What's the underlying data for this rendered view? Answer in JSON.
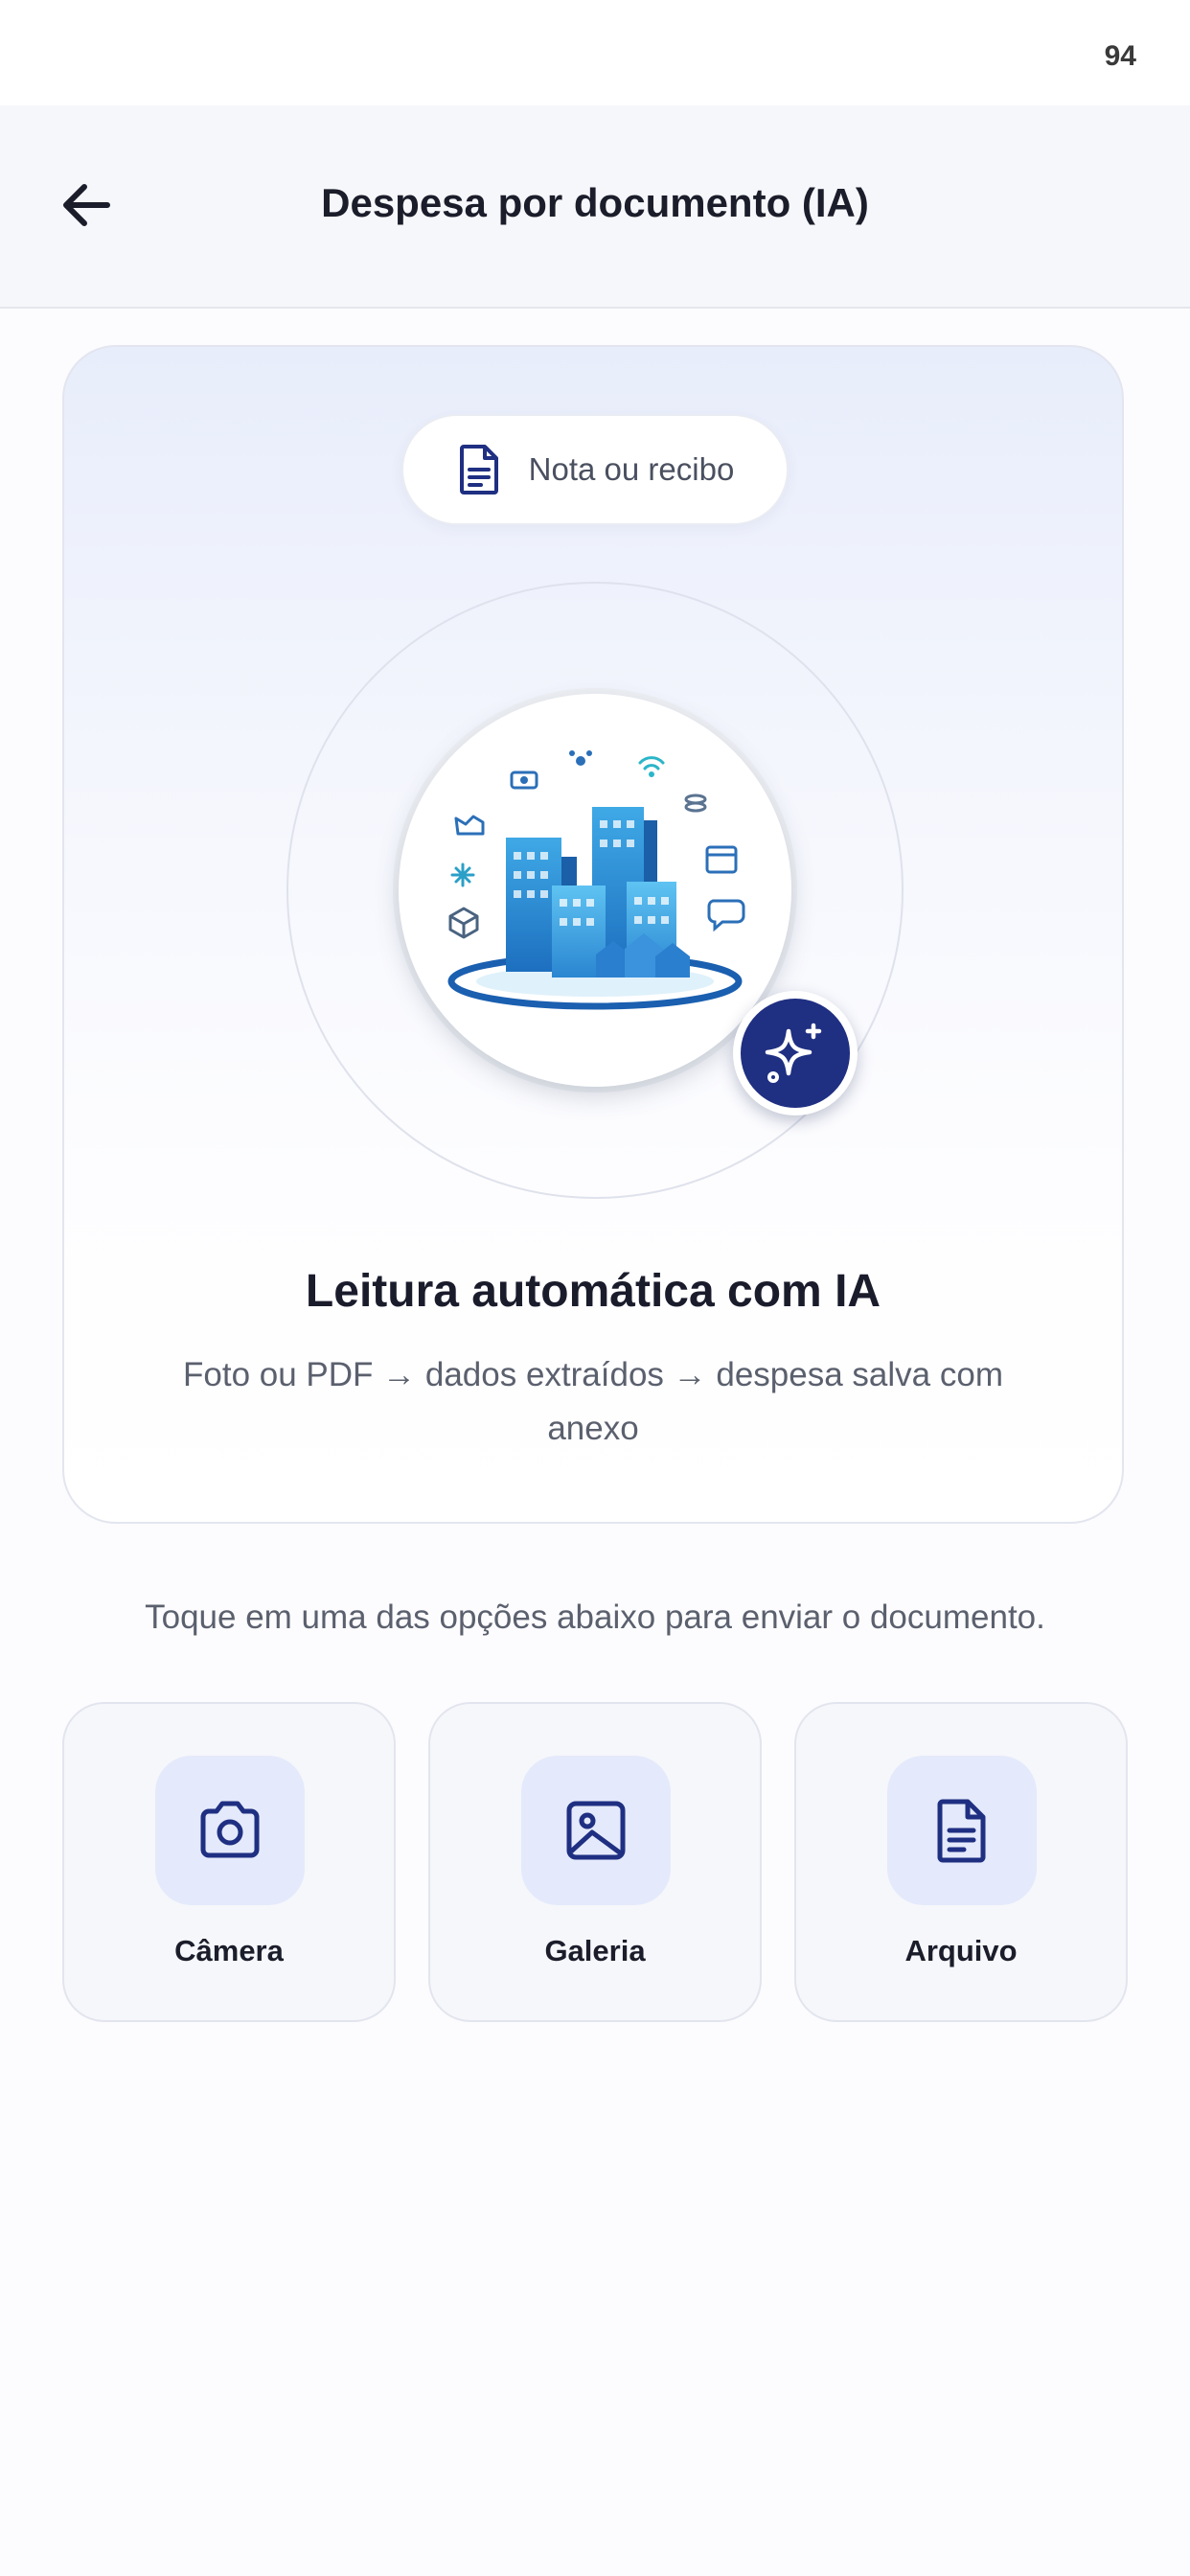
{
  "status_bar": {
    "battery": "94"
  },
  "header": {
    "title": "Despesa por documento (IA)"
  },
  "hero": {
    "pill_label": "Nota ou recibo",
    "title": "Leitura automática com IA",
    "subtitle": "Foto ou PDF → dados extraídos → despesa salva com anexo"
  },
  "instruction": "Toque em uma das opções abaixo para enviar o documento.",
  "options": [
    {
      "label": "Câmera",
      "icon": "camera-icon"
    },
    {
      "label": "Galeria",
      "icon": "image-icon"
    },
    {
      "label": "Arquivo",
      "icon": "document-icon"
    }
  ],
  "colors": {
    "accent": "#1f2f82",
    "icon_bg": "#e4eafb",
    "text_primary": "#1b1d2b",
    "text_secondary": "#5b606e"
  }
}
